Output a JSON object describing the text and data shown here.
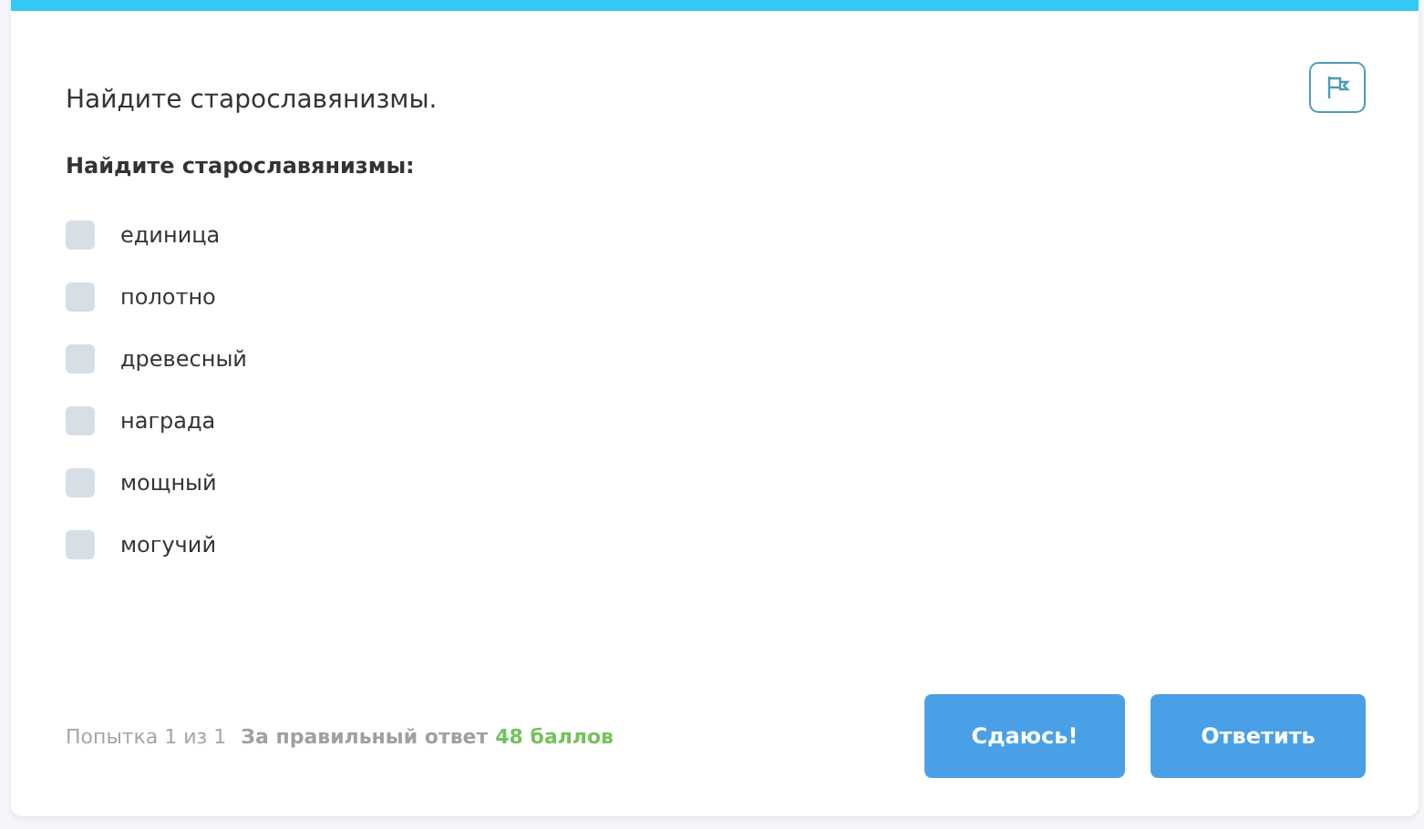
{
  "question": {
    "title": "Найдите старославянизмы.",
    "prompt": "Найдите старославянизмы:"
  },
  "options": [
    {
      "label": "единица",
      "checked": false
    },
    {
      "label": "полотно",
      "checked": false
    },
    {
      "label": "древесный",
      "checked": false
    },
    {
      "label": "награда",
      "checked": false
    },
    {
      "label": "мощный",
      "checked": false
    },
    {
      "label": "могучий",
      "checked": false
    }
  ],
  "footer": {
    "attempt": "Попытка 1 из 1",
    "reward_label": "За правильный ответ",
    "points": "48 баллов"
  },
  "buttons": [
    "Сдаюсь!",
    "Ответить"
  ]
}
